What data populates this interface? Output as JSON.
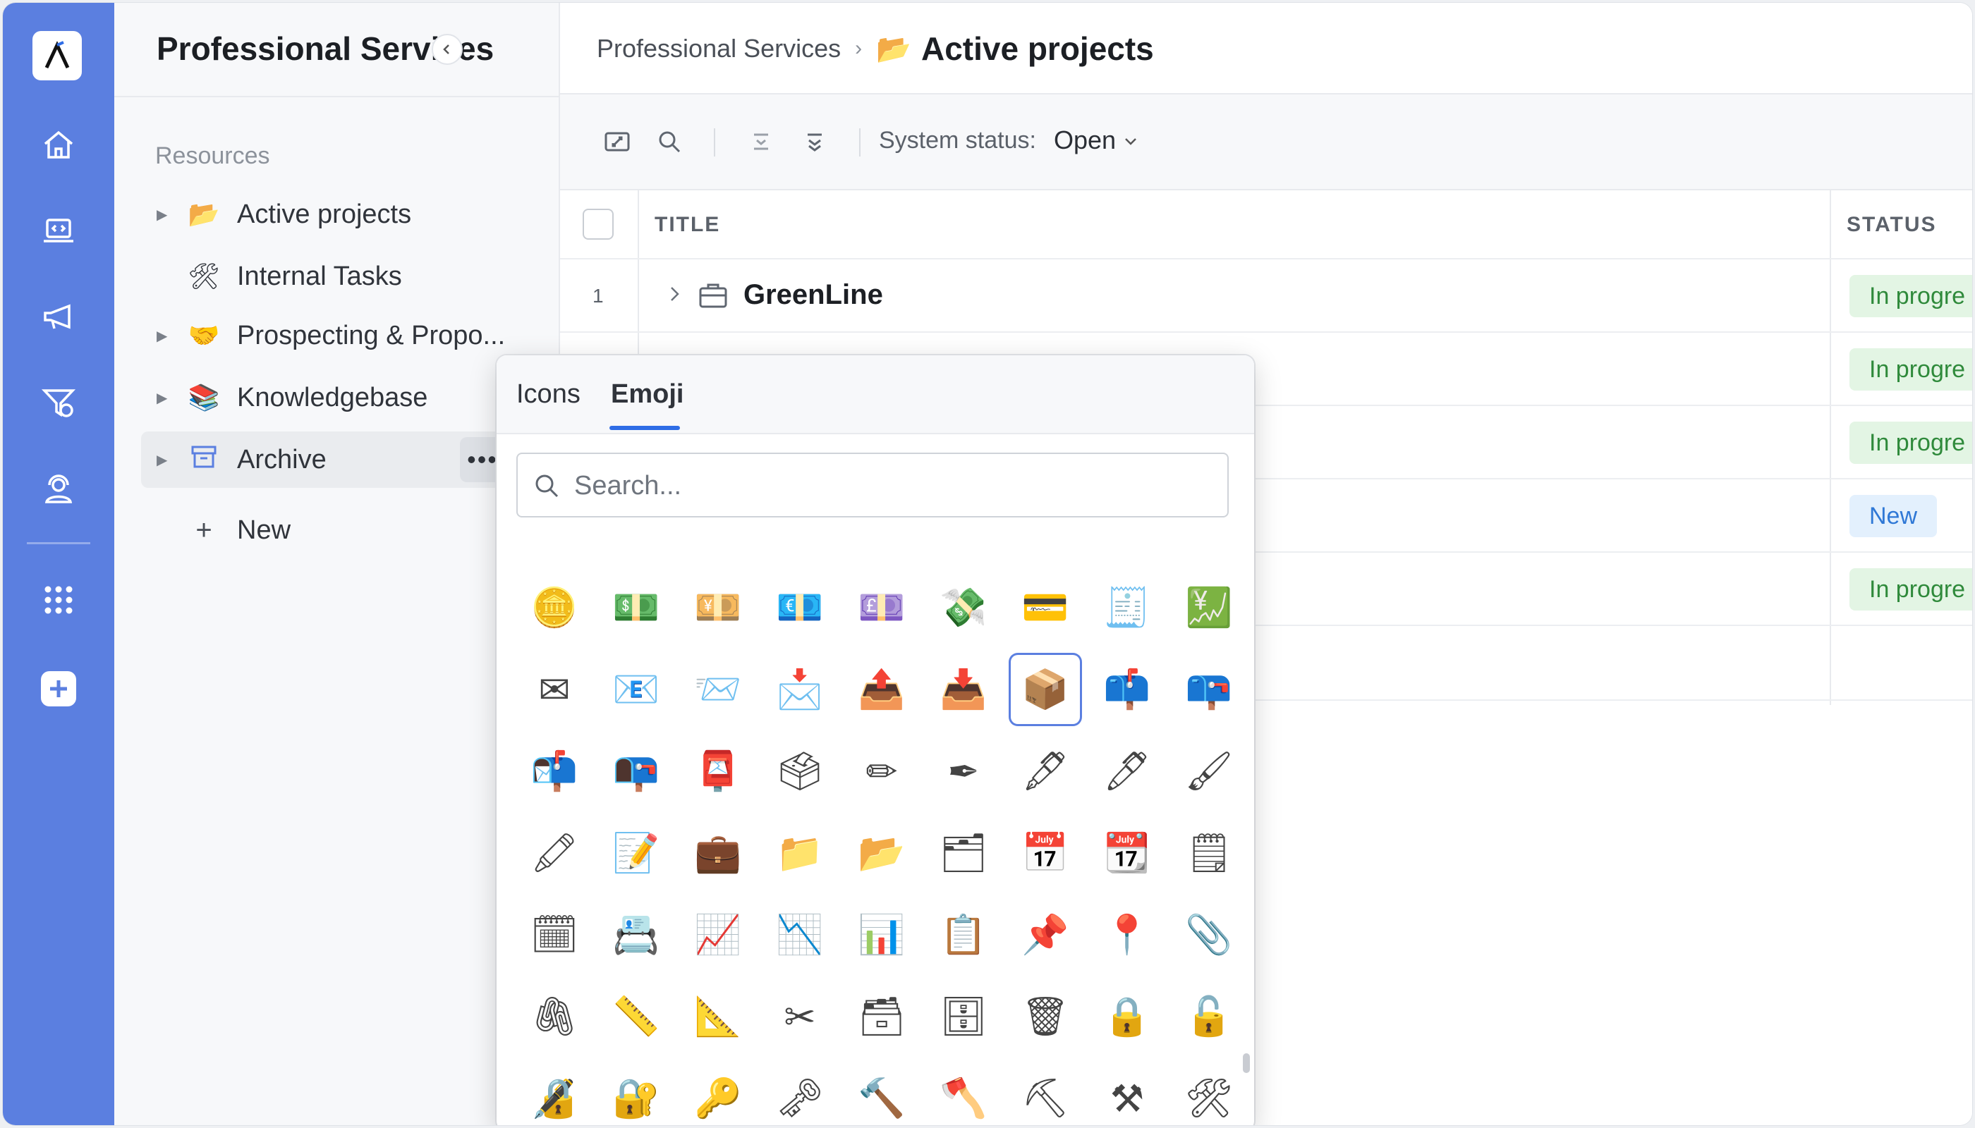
{
  "sidebar": {
    "title": "Professional Services",
    "section": "Resources",
    "items": [
      {
        "label": "Active projects",
        "icon": "📂",
        "has_children": true
      },
      {
        "label": "Internal Tasks",
        "icon": "🛠",
        "has_children": false
      },
      {
        "label": "Prospecting & Propo...",
        "icon": "🤝",
        "has_children": true
      },
      {
        "label": "Knowledgebase",
        "icon": "📚",
        "has_children": true
      },
      {
        "label": "Archive",
        "icon": "🗃",
        "has_children": true
      }
    ],
    "new_label": "New",
    "more_glyph": "•••"
  },
  "breadcrumb": {
    "parent": "Professional Services",
    "separator": "›",
    "current_icon": "📂",
    "current": "Active projects"
  },
  "toolbar": {
    "status_label": "System status:",
    "status_value": "Open"
  },
  "table": {
    "columns": [
      "TITLE",
      "STATUS"
    ],
    "rows": [
      {
        "num": "1",
        "title": "GreenLine",
        "status": "In progre"
      },
      {
        "num": "",
        "title": "",
        "status": "In progre"
      },
      {
        "num": "",
        "title": "",
        "status": "In progre"
      },
      {
        "num": "",
        "title": "",
        "status": "New"
      },
      {
        "num": "",
        "title": "",
        "status": "In progre"
      }
    ]
  },
  "picker": {
    "tabs": [
      "Icons",
      "Emoji"
    ],
    "active_tab": "Emoji",
    "search_placeholder": "Search...",
    "emojis": [
      "🪙",
      "💵",
      "💴",
      "💶",
      "💷",
      "💸",
      "💳",
      "🧾",
      "💹",
      "✉",
      "📧",
      "📨",
      "📩",
      "📤",
      "📥",
      "📦",
      "📫",
      "📪",
      "📬",
      "📭",
      "📮",
      "🗳",
      "✏",
      "✒",
      "🖋",
      "🖊",
      "🖌",
      "🖍",
      "📝",
      "💼",
      "📁",
      "📂",
      "🗂",
      "📅",
      "📆",
      "🗒",
      "🗓",
      "📇",
      "📈",
      "📉",
      "📊",
      "📋",
      "📌",
      "📍",
      "📎",
      "🖇",
      "📏",
      "📐",
      "✂",
      "🗃",
      "🗄",
      "🗑",
      "🔒",
      "🔓",
      "🔏",
      "🔐",
      "🔑",
      "🗝",
      "🔨",
      "🪓",
      "⛏",
      "⚒",
      "🛠"
    ],
    "selected_index": 15
  },
  "colors": {
    "rail": "#5b7fe0",
    "accent": "#2f6de6",
    "badge_progress_bg": "#e3f5e4",
    "badge_progress_fg": "#2f8a3b",
    "badge_new_bg": "#e3f0fd",
    "badge_new_fg": "#2f78d6"
  }
}
